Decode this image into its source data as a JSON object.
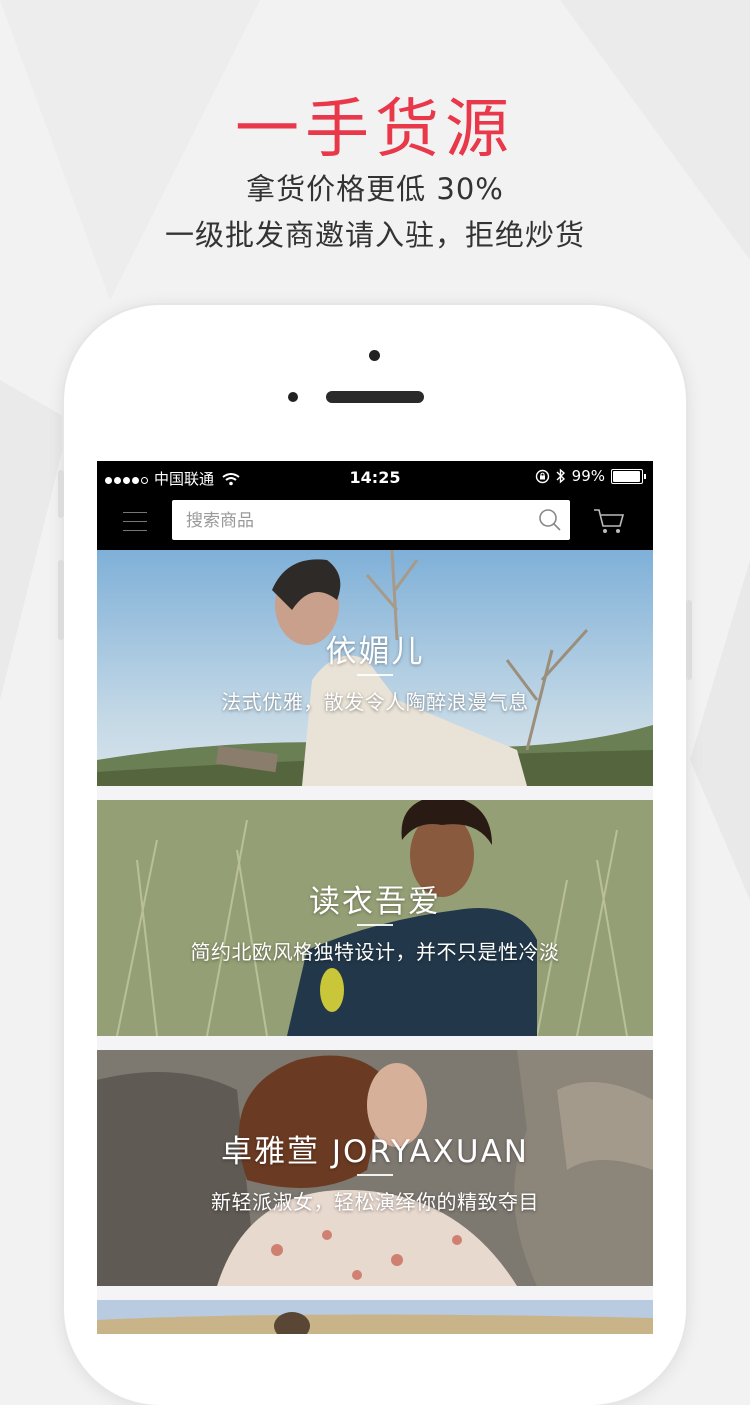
{
  "promo": {
    "headline": "一手货源",
    "line1": "拿货价格更低 30%",
    "line2": "一级批发商邀请入驻，拒绝炒货"
  },
  "statusbar": {
    "carrier": "中国联通",
    "time": "14:25",
    "battery_percent": "99%"
  },
  "navbar": {
    "search_placeholder": "搜索商品",
    "menu_icon": "menu-icon",
    "search_icon": "search-icon",
    "cart_icon": "cart-icon"
  },
  "banners": [
    {
      "title": "依媚儿",
      "desc": "法式优雅，散发令人陶醉浪漫气息"
    },
    {
      "title": "读衣吾爱",
      "desc": "简约北欧风格独特设计，并不只是性冷淡"
    },
    {
      "title": "卓雅萱 JORYAXUAN",
      "desc": "新轻派淑女，轻松演绎你的精致夺目"
    }
  ],
  "colors": {
    "accent": "#e8384a",
    "navbar": "#000000"
  }
}
